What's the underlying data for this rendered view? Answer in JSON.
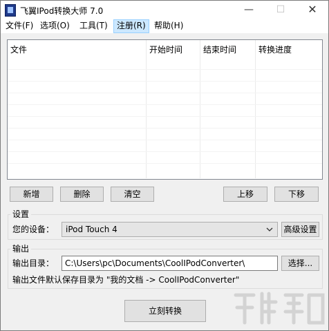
{
  "window": {
    "title": "飞翼IPod转换大师 7.0",
    "minimize_glyph": "—",
    "maximize_glyph": "☐",
    "close_glyph": "✕"
  },
  "menu": {
    "items": [
      {
        "label": "文件(F)"
      },
      {
        "label": "选项(O)"
      },
      {
        "label": "工具(T)"
      },
      {
        "label": "注册(R)"
      },
      {
        "label": "帮助(H)"
      }
    ],
    "highlighted_index": 3
  },
  "list": {
    "columns": [
      "文件",
      "开始时间",
      "结束时间",
      "转换进度"
    ],
    "rows": []
  },
  "toolbar": {
    "add_label": "新增",
    "delete_label": "删除",
    "clear_label": "清空",
    "move_up_label": "上移",
    "move_down_label": "下移"
  },
  "settings": {
    "group_title": "设置",
    "device_label": "您的设备：",
    "device_value": "iPod Touch 4",
    "advanced_label": "高级设置"
  },
  "output": {
    "group_title": "输出",
    "dir_label": "输出目录：",
    "dir_value": "C:\\Users\\pc\\Documents\\CoolIPodConverter\\",
    "browse_label": "选择...",
    "note": "输出文件默认保存目录为 \"我的文档 -> CoolIPodConverter\""
  },
  "actions": {
    "convert_label": "立刻转换"
  },
  "colors": {
    "window_bg": "#f0f0f0",
    "menu_highlight": "#cce8ff",
    "button_bg": "#e1e1e1"
  }
}
